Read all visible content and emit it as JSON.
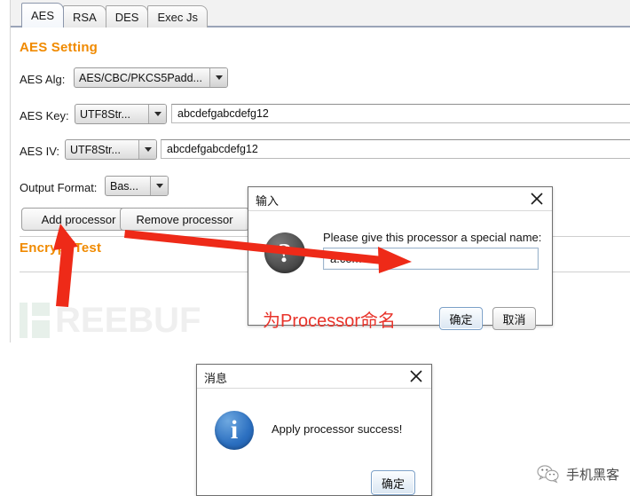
{
  "window": {
    "tabs": [
      {
        "label": "AES",
        "selected": true
      },
      {
        "label": "RSA",
        "selected": false
      },
      {
        "label": "DES",
        "selected": false
      },
      {
        "label": "Exec Js",
        "selected": false
      }
    ]
  },
  "aes_setting": {
    "title": "AES Setting",
    "alg": {
      "label": "AES Alg:",
      "value": "AES/CBC/PKCS5Padd...",
      "arrow_icon": "chevron-down-icon"
    },
    "key": {
      "label": "AES Key:",
      "encoding": "UTF8Str...",
      "value": "abcdefgabcdefg12"
    },
    "iv": {
      "label": "AES IV:",
      "encoding": "UTF8Str...",
      "value": "abcdefgabcdefg12"
    },
    "output_format": {
      "label": "Output Format:",
      "value": "Bas..."
    },
    "buttons": {
      "add": "Add processor",
      "remove": "Remove processor"
    }
  },
  "encrypt_test": {
    "title": "Encrypt Test"
  },
  "input_dialog": {
    "title": "输入",
    "close_icon": "close-icon",
    "icon": "question-icon",
    "icon_glyph": "?",
    "prompt": "Please give this processor a special name:",
    "input_value": "a.com",
    "ok_label": "确定",
    "cancel_label": "取消",
    "annotation": "为Processor命名"
  },
  "message_dialog": {
    "title": "消息",
    "close_icon": "close-icon",
    "icon": "info-icon",
    "icon_glyph": "i",
    "message": "Apply processor success!",
    "ok_label": "确定"
  },
  "watermark": {
    "text": "REEBUF",
    "text2": "REEBU"
  },
  "wechat_badge": {
    "icon": "wechat-icon",
    "text": "手机黑客"
  },
  "colors": {
    "accent_orange": "#f08a00",
    "annotation_red": "#e8332a",
    "info_blue": "#2b6fc0",
    "watermark_gray": "#efefef",
    "watermark_green": "#e7f0ea"
  }
}
